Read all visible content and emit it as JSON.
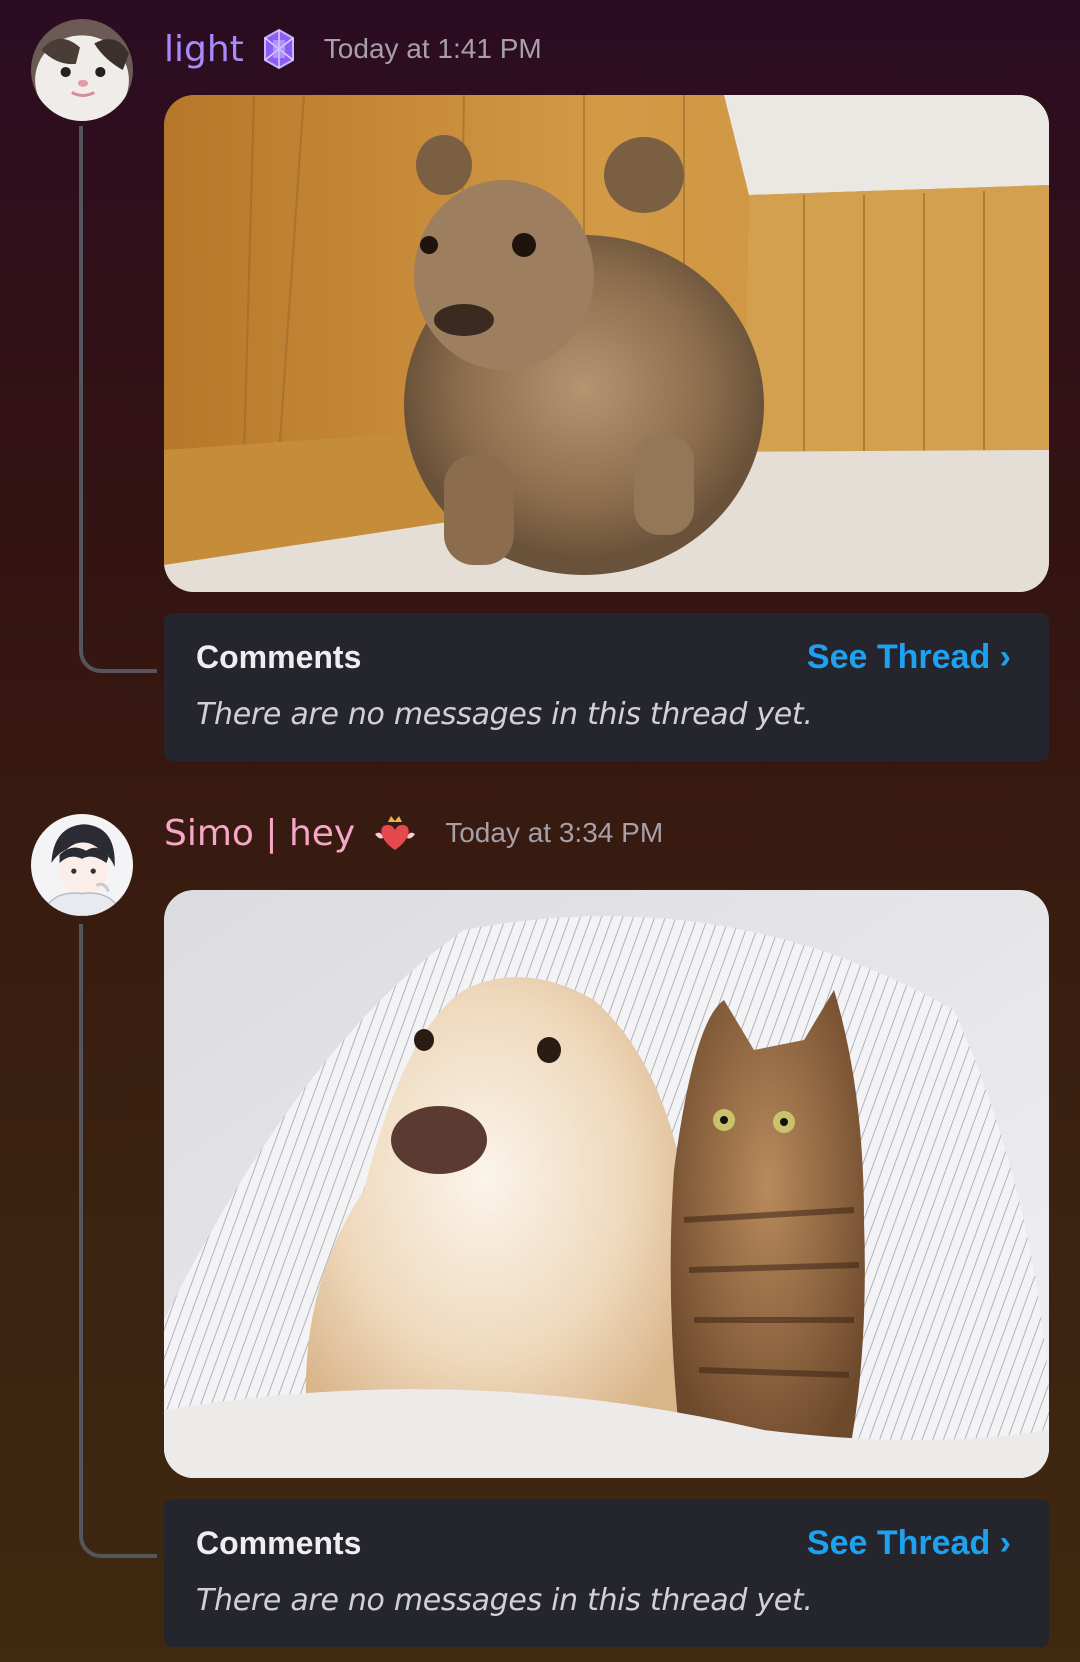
{
  "messages": [
    {
      "username": "light",
      "role_icon": "purple-gem-icon",
      "timestamp": "Today at 1:41 PM",
      "attachment": "lion-cub-photo",
      "comments": {
        "title": "Comments",
        "see_thread": "See Thread ›",
        "empty_text": "There are no messages in this thread yet."
      }
    },
    {
      "username": "Simo | hey",
      "role_icon": "crowned-heart-icon",
      "timestamp": "Today at 3:34 PM",
      "attachment": "dog-and-cat-under-blanket-photo",
      "comments": {
        "title": "Comments",
        "see_thread": "See Thread ›",
        "empty_text": "There are no messages in this thread yet."
      }
    }
  ],
  "colors": {
    "username_1": "#a78bfa",
    "username_2": "#f7a6c8",
    "link": "#1ea1f1",
    "card_bg": "#24252d"
  }
}
